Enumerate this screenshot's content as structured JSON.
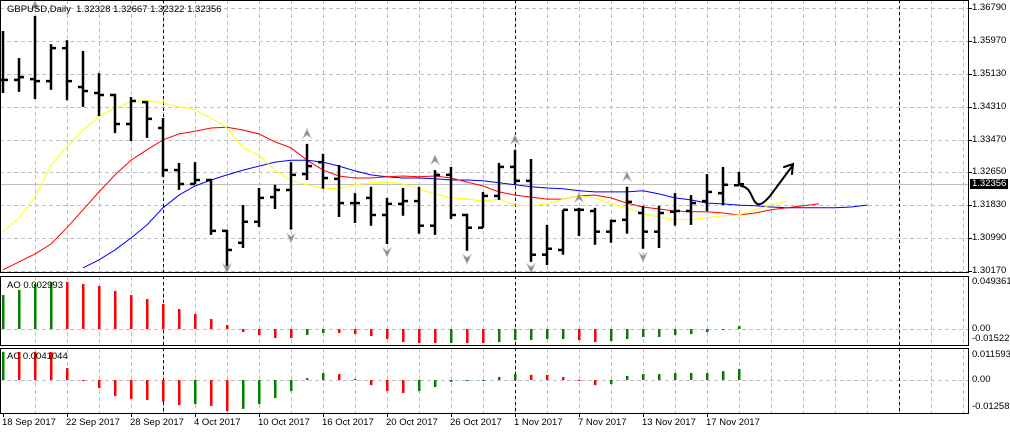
{
  "header": {
    "symbol": "GBPUSD,Daily",
    "open": "1.32328",
    "high": "1.32667",
    "low": "1.32322",
    "close": "1.32356"
  },
  "price_axis": {
    "labels": [
      "1.36790",
      "1.35970",
      "1.35130",
      "1.34310",
      "1.33470",
      "1.32650",
      "1.31830",
      "1.30990",
      "1.30170"
    ],
    "current": "1.32356"
  },
  "ao_panel": {
    "name": "AO",
    "value": "0.002993",
    "axis": [
      "0.049361",
      "0.00",
      "-0.015225"
    ]
  },
  "ac_panel": {
    "name": "AC",
    "value": "0.0041044",
    "axis": [
      "0.011593",
      "0.00",
      "-0.012581"
    ]
  },
  "time_axis": [
    {
      "bar": 0,
      "label": "18 Sep 2017"
    },
    {
      "bar": 4,
      "label": "22 Sep 2017"
    },
    {
      "bar": 8,
      "label": "28 Sep 2017"
    },
    {
      "bar": 12,
      "label": "4 Oct 2017"
    },
    {
      "bar": 16,
      "label": "10 Oct 2017"
    },
    {
      "bar": 20,
      "label": "16 Oct 2017"
    },
    {
      "bar": 24,
      "label": "20 Oct 2017"
    },
    {
      "bar": 28,
      "label": "26 Oct 2017"
    },
    {
      "bar": 32,
      "label": "1 Nov 2017"
    },
    {
      "bar": 36,
      "label": "7 Nov 2017"
    },
    {
      "bar": 40,
      "label": "13 Nov 2017"
    },
    {
      "bar": 44,
      "label": "17 Nov 2017"
    }
  ],
  "colors": {
    "bars": "#000000",
    "jaw": "#0000ff",
    "teeth": "#ff0000",
    "lips": "#ffff00",
    "up": "#008000",
    "down": "#ff0000",
    "grid": "#c0c0c0",
    "fractal": "#8a8a8a"
  },
  "chart_data": {
    "type": "ohlc",
    "ylim": [
      1.3017,
      1.3679
    ],
    "bars": [
      [
        1.3498,
        1.3621,
        1.3465,
        1.3498
      ],
      [
        1.3498,
        1.3553,
        1.3468,
        1.3505
      ],
      [
        1.35,
        1.3659,
        1.345,
        1.3495
      ],
      [
        1.3495,
        1.3588,
        1.3473,
        1.3578
      ],
      [
        1.3578,
        1.3598,
        1.3447,
        1.3495
      ],
      [
        1.348,
        1.3571,
        1.343,
        1.347
      ],
      [
        1.3465,
        1.3515,
        1.3407,
        1.346
      ],
      [
        1.346,
        1.3463,
        1.3364,
        1.3387
      ],
      [
        1.3387,
        1.3455,
        1.3344,
        1.3445
      ],
      [
        1.3442,
        1.3445,
        1.3352,
        1.34
      ],
      [
        1.3377,
        1.3402,
        1.3254,
        1.3271
      ],
      [
        1.3271,
        1.3289,
        1.3221,
        1.3236
      ],
      [
        1.3236,
        1.3291,
        1.3236,
        1.3246
      ],
      [
        1.3246,
        1.3249,
        1.3108,
        1.3118
      ],
      [
        1.3118,
        1.3121,
        1.3025,
        1.307
      ],
      [
        1.3088,
        1.3183,
        1.3075,
        1.3141
      ],
      [
        1.3141,
        1.3226,
        1.3128,
        1.3201
      ],
      [
        1.3203,
        1.3234,
        1.3173,
        1.3221
      ],
      [
        1.3221,
        1.3291,
        1.3121,
        1.3259
      ],
      [
        1.3261,
        1.3337,
        1.3246,
        1.3281
      ],
      [
        1.3291,
        1.3312,
        1.3224,
        1.3251
      ],
      [
        1.3249,
        1.3284,
        1.3153,
        1.3188
      ],
      [
        1.3188,
        1.3213,
        1.3138,
        1.3188
      ],
      [
        1.3201,
        1.3229,
        1.3131,
        1.3158
      ],
      [
        1.3158,
        1.3201,
        1.3085,
        1.3186
      ],
      [
        1.3186,
        1.3226,
        1.3156,
        1.3193
      ],
      [
        1.3193,
        1.3229,
        1.3111,
        1.3131
      ],
      [
        1.3131,
        1.3271,
        1.3108,
        1.3259
      ],
      [
        1.3259,
        1.3279,
        1.3148,
        1.3158
      ],
      [
        1.3158,
        1.3161,
        1.3068,
        1.3126
      ],
      [
        1.3126,
        1.3216,
        1.3126,
        1.3206
      ],
      [
        1.3206,
        1.3289,
        1.3196,
        1.3279
      ],
      [
        1.3279,
        1.3322,
        1.3234,
        1.3244
      ],
      [
        1.3244,
        1.3299,
        1.304,
        1.3058
      ],
      [
        1.3058,
        1.3133,
        1.3032,
        1.3073
      ],
      [
        1.307,
        1.3171,
        1.3058,
        1.3171
      ],
      [
        1.3171,
        1.3176,
        1.3105,
        1.3171
      ],
      [
        1.3168,
        1.3176,
        1.3083,
        1.3116
      ],
      [
        1.3116,
        1.3146,
        1.3088,
        1.3143
      ],
      [
        1.3146,
        1.3229,
        1.3111,
        1.3191
      ],
      [
        1.3163,
        1.3181,
        1.3073,
        1.3116
      ],
      [
        1.3116,
        1.3181,
        1.3075,
        1.3163
      ],
      [
        1.3166,
        1.3213,
        1.3131,
        1.3168
      ],
      [
        1.3168,
        1.3208,
        1.3133,
        1.3188
      ],
      [
        1.3193,
        1.3261,
        1.3168,
        1.3216
      ],
      [
        1.3213,
        1.3279,
        1.3183,
        1.3234
      ],
      [
        1.32328,
        1.32667,
        1.32322,
        1.32356
      ]
    ],
    "alligator": {
      "lips": [
        1.3115,
        1.3151,
        1.3203,
        1.3283,
        1.3329,
        1.3372,
        1.3405,
        1.3427,
        1.3442,
        1.3447,
        1.344,
        1.343,
        1.3422,
        1.3402,
        1.3377,
        1.3327,
        1.3309,
        1.3271,
        1.3244,
        1.3234,
        1.3226,
        1.3224,
        1.3234,
        1.3239,
        1.3241,
        1.3236,
        1.3224,
        1.3211,
        1.3201,
        1.3198,
        1.3193,
        1.3198,
        1.3183,
        1.3181,
        1.3186,
        1.3198,
        1.3206,
        1.3201,
        1.3186,
        1.3176,
        1.3161,
        1.3153,
        1.3146,
        1.3146,
        1.3151,
        1.3156,
        1.3158,
        1.3171,
        1.3183,
        1.3193
      ],
      "teeth": [
        1.302,
        1.304,
        1.306,
        1.3085,
        1.3126,
        1.3171,
        1.3216,
        1.3259,
        1.3296,
        1.3322,
        1.3347,
        1.3362,
        1.3369,
        1.3377,
        1.3379,
        1.3372,
        1.3362,
        1.3342,
        1.3327,
        1.3296,
        1.3271,
        1.3256,
        1.3251,
        1.3251,
        1.3254,
        1.3256,
        1.3254,
        1.3256,
        1.3251,
        1.3241,
        1.3231,
        1.3216,
        1.3208,
        1.3203,
        1.3198,
        1.3198,
        1.3206,
        1.3208,
        1.3201,
        1.3188,
        1.3178,
        1.3173,
        1.3168,
        1.3166,
        1.3166,
        1.3163,
        1.3158,
        1.3163,
        1.3171,
        1.3176,
        1.3181,
        1.3186
      ],
      "jaw": [
        null,
        null,
        null,
        null,
        null,
        1.3025,
        1.3045,
        1.307,
        1.31,
        1.3133,
        1.3176,
        1.3208,
        1.3231,
        1.3246,
        1.3259,
        1.3271,
        1.3281,
        1.3291,
        1.3296,
        1.3296,
        1.3291,
        1.3281,
        1.3269,
        1.3259,
        1.3254,
        1.3251,
        1.3251,
        1.3249,
        1.3246,
        1.3246,
        1.3244,
        1.3239,
        1.3234,
        1.3229,
        1.3226,
        1.3224,
        1.3219,
        1.3216,
        1.3216,
        1.3216,
        1.3219,
        1.3211,
        1.3201,
        1.3196,
        1.3188,
        1.3186,
        1.3183,
        1.3181,
        1.3178,
        1.3176,
        1.3176,
        1.3176,
        1.3176,
        1.3178,
        1.3183
      ]
    },
    "fractals": {
      "up": [
        2,
        19,
        27,
        32,
        36,
        39
      ],
      "down": [
        14,
        18,
        24,
        29,
        33,
        40
      ]
    },
    "ao": {
      "values": [
        0.0357,
        0.041,
        0.0473,
        0.0494,
        0.0494,
        0.0473,
        0.0452,
        0.0399,
        0.0357,
        0.0315,
        0.0263,
        0.021,
        0.0158,
        0.0105,
        0.0042,
        -0.0032,
        -0.0063,
        -0.0095,
        -0.0095,
        -0.0063,
        -0.0042,
        -0.0042,
        -0.0053,
        -0.0074,
        -0.0105,
        -0.0137,
        -0.0147,
        -0.0147,
        -0.0147,
        -0.0147,
        -0.0147,
        -0.0137,
        -0.0116,
        -0.0116,
        -0.0105,
        -0.0105,
        -0.0116,
        -0.0137,
        -0.0126,
        -0.0105,
        -0.0084,
        -0.0084,
        -0.0063,
        -0.0053,
        -0.0032,
        -0.0011,
        0.003
      ],
      "colors": [
        "up",
        "up",
        "up",
        "up",
        "down",
        "down",
        "down",
        "down",
        "down",
        "down",
        "down",
        "down",
        "down",
        "down",
        "down",
        "down",
        "down",
        "down",
        "down",
        "up",
        "up",
        "down",
        "down",
        "down",
        "down",
        "down",
        "down",
        "down",
        "up",
        "down",
        "down",
        "up",
        "up",
        "up",
        "up",
        "up",
        "down",
        "down",
        "up",
        "up",
        "up",
        "up",
        "up",
        "up",
        "up",
        "up",
        "up"
      ],
      "ylim": [
        -0.015225,
        0.049361
      ]
    },
    "ac": {
      "values": [
        0.0104,
        0.0104,
        0.0104,
        0.0104,
        0.0044,
        -0.0004,
        -0.003,
        -0.0059,
        -0.007,
        -0.0074,
        -0.0081,
        -0.0093,
        -0.0089,
        -0.0096,
        -0.0115,
        -0.0107,
        -0.0089,
        -0.0067,
        -0.0041,
        0.0007,
        0.0026,
        0.0022,
        0.0004,
        -0.0019,
        -0.0041,
        -0.0048,
        -0.0041,
        -0.0026,
        -0.0007,
        -0.0002,
        -0.0002,
        0.0011,
        0.0022,
        0.0019,
        0.0019,
        0.0011,
        -0.0002,
        -0.0019,
        -0.0015,
        0.0015,
        0.0022,
        0.0022,
        0.0026,
        0.0026,
        0.0026,
        0.0033,
        0.0041
      ],
      "colors": [
        "up",
        "down",
        "down",
        "down",
        "down",
        "down",
        "down",
        "down",
        "down",
        "down",
        "down",
        "down",
        "up",
        "down",
        "down",
        "up",
        "up",
        "up",
        "up",
        "up",
        "up",
        "down",
        "down",
        "down",
        "down",
        "down",
        "up",
        "up",
        "up",
        "up",
        "up",
        "up",
        "up",
        "down",
        "down",
        "down",
        "down",
        "down",
        "up",
        "up",
        "up",
        "up",
        "up",
        "up",
        "up",
        "up",
        "up"
      ],
      "ylim": [
        -0.012581,
        0.011593
      ]
    }
  }
}
